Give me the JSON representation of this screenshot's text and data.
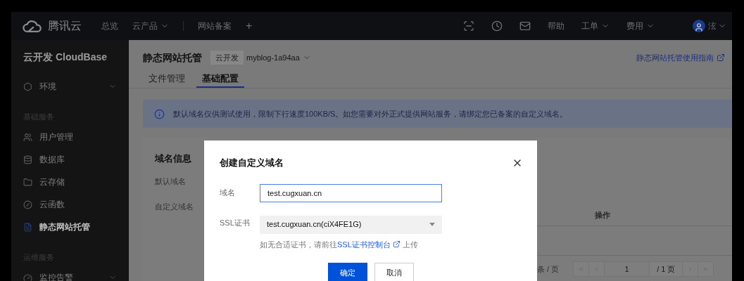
{
  "top_nav": {
    "brand": "腾讯云",
    "left_items": [
      {
        "label": "总览",
        "has_menu": false
      },
      {
        "label": "云产品",
        "has_menu": true
      },
      {
        "label": "网站备案",
        "has_menu": false
      },
      {
        "label": "+",
        "has_menu": false
      }
    ],
    "right_items": [
      {
        "label": "帮助",
        "has_menu": false
      },
      {
        "label": "工单",
        "has_menu": true
      },
      {
        "label": "费用",
        "has_menu": true
      }
    ],
    "user": {
      "label": "泫",
      "has_menu": true
    }
  },
  "sidebar": {
    "title": "云开发 CloudBase",
    "items": [
      {
        "kind": "item",
        "label": "环境",
        "has_menu": true,
        "selected": false
      },
      {
        "kind": "section",
        "label": "基础服务"
      },
      {
        "kind": "item",
        "label": "用户管理",
        "has_menu": false,
        "selected": false
      },
      {
        "kind": "item",
        "label": "数据库",
        "has_menu": false,
        "selected": false
      },
      {
        "kind": "item",
        "label": "云存储",
        "has_menu": false,
        "selected": false
      },
      {
        "kind": "item",
        "label": "云函数",
        "has_menu": false,
        "selected": false
      },
      {
        "kind": "item",
        "label": "静态网站托管",
        "has_menu": false,
        "selected": true
      },
      {
        "kind": "section",
        "label": "运维服务"
      },
      {
        "kind": "item",
        "label": "监控告警",
        "has_menu": true,
        "selected": false
      }
    ]
  },
  "header": {
    "title": "静态网站托管",
    "tag": "云开发",
    "env": "myblog-1a94aa",
    "guide_link": "静态网站托管使用指南"
  },
  "tabs": [
    {
      "label": "文件管理",
      "selected": false
    },
    {
      "label": "基础配置",
      "selected": true
    }
  ],
  "notice": "默认域名仅供测试使用，限制下行速度100KB/S。如您需要对外正式提供网站服务，请绑定您已备案的自定义域名。",
  "card": {
    "title": "域名信息",
    "labels": [
      "默认域名",
      "自定义域名"
    ],
    "table": {
      "columns": [
        "操作"
      ]
    },
    "pagination": {
      "per_page": "条 / 页",
      "page": "1",
      "total": "/ 1 页"
    }
  },
  "dialog": {
    "title": "创建自定义域名",
    "domain": {
      "label": "域名",
      "value": "test.cugxuan.cn"
    },
    "ssl": {
      "label": "SSL证书",
      "value": "test.cugxuan.cn(ciX4FE1G)"
    },
    "hint": {
      "before": "如无合适证书，请前往",
      "link": "SSL证书控制台",
      "after": "上传"
    },
    "buttons": [
      {
        "label": "确定",
        "kind": "primary"
      },
      {
        "label": "取消",
        "kind": "secondary"
      }
    ]
  }
}
